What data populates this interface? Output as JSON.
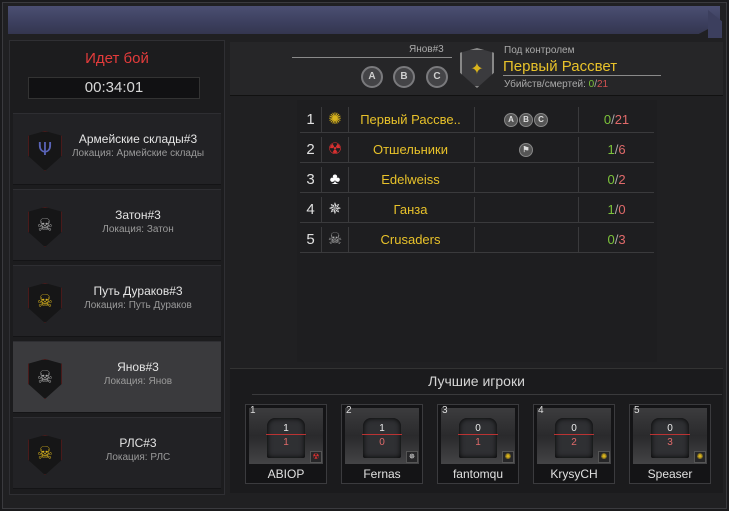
{
  "battle": {
    "status": "Идет бой",
    "timer": "00:34:01"
  },
  "locations": [
    {
      "name": "Армейские склады#3",
      "sub": "Локация: Армейские склады",
      "icon": "trident-emblem-icon",
      "color": "#5a64b8"
    },
    {
      "name": "Затон#3",
      "sub": "Локация: Затон",
      "icon": "skull-emblem-icon",
      "color": "#aaaaaa"
    },
    {
      "name": "Путь Дураков#3",
      "sub": "Локация: Путь Дураков",
      "icon": "skull-yellow-emblem-icon",
      "color": "#d8b31c"
    },
    {
      "name": "Янов#3",
      "sub": "Локация: Янов",
      "icon": "skull-emblem-icon",
      "color": "#aaaaaa"
    },
    {
      "name": "РЛС#3",
      "sub": "Локация: РЛС",
      "icon": "skull-yellow-emblem-icon",
      "color": "#d8b31c"
    }
  ],
  "header": {
    "location": "Янов#3",
    "points": [
      "A",
      "B",
      "C"
    ],
    "under_control_label": "Под контролем",
    "under_control_name": "Первый Рассвет",
    "kd_label": "Убийств/смертей:",
    "kills": "0",
    "sep": "/",
    "deaths": "21"
  },
  "clans": [
    {
      "rank": "1",
      "name": "Первый Рассве..",
      "points": [
        "A",
        "B",
        "C"
      ],
      "flag": "",
      "kills": "0",
      "deaths": "21",
      "emblem": "laurel-emblem-icon",
      "color": "#d8b31c"
    },
    {
      "rank": "2",
      "name": "Отшельники",
      "points": [],
      "flag": "⚑",
      "kills": "1",
      "deaths": "6",
      "emblem": "biohazard-emblem-icon",
      "color": "#d83030"
    },
    {
      "rank": "3",
      "name": "Edelweiss",
      "points": [],
      "flag": "",
      "kills": "0",
      "deaths": "2",
      "emblem": "clover-emblem-icon",
      "color": "#ffffff"
    },
    {
      "rank": "4",
      "name": "Ганза",
      "points": [],
      "flag": "",
      "kills": "1",
      "deaths": "0",
      "emblem": "compass-star-emblem-icon",
      "color": "#dddddd"
    },
    {
      "rank": "5",
      "name": "Crusaders",
      "points": [],
      "flag": "",
      "kills": "0",
      "deaths": "3",
      "emblem": "skull-emblem-icon",
      "color": "#aaaaaa"
    }
  ],
  "best_players": {
    "title": "Лучшие игроки",
    "players": [
      {
        "index": "1",
        "name": "ABIOP",
        "kills": "1",
        "deaths": "1",
        "badge": "biohazard-badge-icon"
      },
      {
        "index": "2",
        "name": "Fernas",
        "kills": "1",
        "deaths": "0",
        "badge": "compass-badge-icon"
      },
      {
        "index": "3",
        "name": "fantomqu",
        "kills": "0",
        "deaths": "1",
        "badge": "laurel-badge-icon"
      },
      {
        "index": "4",
        "name": "KrysyCH",
        "kills": "0",
        "deaths": "2",
        "badge": "laurel-badge-icon"
      },
      {
        "index": "5",
        "name": "Speaser",
        "kills": "0",
        "deaths": "3",
        "badge": "laurel-badge-icon"
      }
    ]
  }
}
